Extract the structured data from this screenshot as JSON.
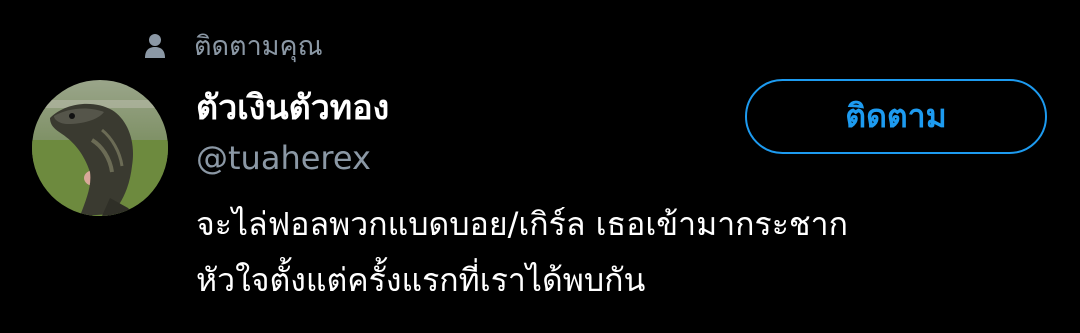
{
  "context": {
    "icon": "person-icon",
    "label": "ติดตามคุณ"
  },
  "user": {
    "display_name": "ตัวเงินตัวทอง",
    "handle": "@tuaherex",
    "avatar": "monitor-lizard-avatar"
  },
  "bio": {
    "line1": "จะไล่ฟอลพวกแบดบอย/เกิร์ล เธอเข้ามากระชาก",
    "line2": "หัวใจตั้งแต่ครั้งแรกที่เราได้พบกัน"
  },
  "follow_button": {
    "label": "ติดตาม"
  },
  "colors": {
    "background": "#000000",
    "secondary_text": "#8b98a5",
    "accent": "#1d9bf0",
    "primary_text": "#ffffff"
  }
}
